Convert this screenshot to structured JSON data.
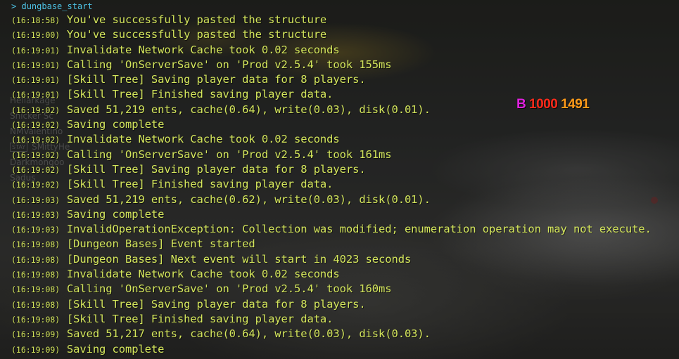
{
  "colors": {
    "log_text": "#d4e65c",
    "prompt_text": "#4dc3e6",
    "hud_b": "#e020e0",
    "hud_value1": "#ff2a1a",
    "hud_value2": "#ff9a18"
  },
  "console": {
    "prompt_symbol": ">",
    "command": "dungbase_start",
    "lines": [
      {
        "time": "(16:18:58)",
        "text": "You've successfully pasted the structure"
      },
      {
        "time": "(16:19:00)",
        "text": "You've successfully pasted the structure"
      },
      {
        "time": "(16:19:01)",
        "text": "Invalidate Network Cache took 0.02 seconds"
      },
      {
        "time": "(16:19:01)",
        "text": "Calling 'OnServerSave' on 'Prod v2.5.4' took 155ms"
      },
      {
        "time": "(16:19:01)",
        "text": "[Skill Tree] Saving player data for 8 players."
      },
      {
        "time": "(16:19:01)",
        "text": "[Skill Tree] Finished saving player data."
      },
      {
        "time": "(16:19:02)",
        "text": "Saved 51,219 ents, cache(0.64), write(0.03), disk(0.01)."
      },
      {
        "time": "(16:19:02)",
        "text": "Saving complete"
      },
      {
        "time": "(16:19:02)",
        "text": "Invalidate Network Cache took 0.02 seconds"
      },
      {
        "time": "(16:19:02)",
        "text": "Calling 'OnServerSave' on 'Prod v2.5.4' took 161ms"
      },
      {
        "time": "(16:19:02)",
        "text": "[Skill Tree] Saving player data for 8 players."
      },
      {
        "time": "(16:19:02)",
        "text": "[Skill Tree] Finished saving player data."
      },
      {
        "time": "(16:19:03)",
        "text": "Saved 51,219 ents, cache(0.62), write(0.03), disk(0.01)."
      },
      {
        "time": "(16:19:03)",
        "text": "Saving complete"
      },
      {
        "time": "(16:19:03)",
        "text": "InvalidOperationException: Collection was modified; enumeration operation may not execute."
      },
      {
        "time": "(16:19:08)",
        "text": "[Dungeon Bases] Event started"
      },
      {
        "time": "(16:19:08)",
        "text": "[Dungeon Bases] Next event will start in 4023 seconds"
      },
      {
        "time": "(16:19:08)",
        "text": "Invalidate Network Cache took 0.02 seconds"
      },
      {
        "time": "(16:19:08)",
        "text": "Calling 'OnServerSave' on 'Prod v2.5.4' took 160ms"
      },
      {
        "time": "(16:19:08)",
        "text": "[Skill Tree] Saving player data for 8 players."
      },
      {
        "time": "(16:19:08)",
        "text": "[Skill Tree] Finished saving player data."
      },
      {
        "time": "(16:19:09)",
        "text": "Saved 51,217 ents, cache(0.64), write(0.03), disk(0.03)."
      },
      {
        "time": "(16:19:09)",
        "text": "Saving complete"
      }
    ]
  },
  "hud": {
    "label": "B",
    "value1": "1000",
    "value2": "1491"
  },
  "background_list": [
    {
      "name": "Heliarkage"
    },
    {
      "name": "Snicker Sc"
    },
    {
      "name": "NMValentino"
    },
    {
      "tag": "STAY",
      "name": "SMittyHe"
    },
    {
      "name": "Darkmongoo"
    },
    {
      "name": "Sadus"
    }
  ]
}
